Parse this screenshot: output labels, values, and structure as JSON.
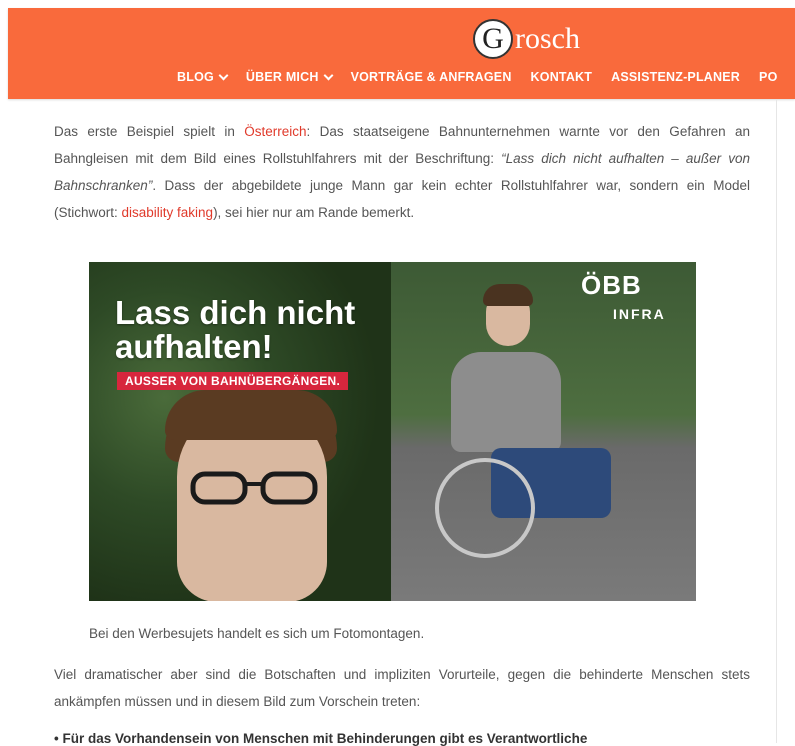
{
  "header": {
    "logo_letter": "G",
    "logo_text": "rosch",
    "nav": [
      {
        "label": "BLOG",
        "dropdown": true
      },
      {
        "label": "ÜBER MICH",
        "dropdown": true
      },
      {
        "label": "VORTRÄGE & ANFRAGEN",
        "dropdown": false
      },
      {
        "label": "KONTAKT",
        "dropdown": false
      },
      {
        "label": "ASSISTENZ-PLANER",
        "dropdown": false
      },
      {
        "label": "PO",
        "dropdown": false
      }
    ]
  },
  "article": {
    "p1_a": "Das erste Beispiel spielt in ",
    "p1_link1": "Österreich",
    "p1_b": ": Das staatseigene Bahnunternehmen warnte vor den Gefahren an Bahngleisen mit dem Bild eines Rollstuhlfahrers mit der Beschriftung: ",
    "p1_quote": "“Lass dich nicht aufhalten – außer von Bahnschranken”",
    "p1_c": ". Dass der abgebildete junge Mann gar kein echter Rollstuhlfahrer war, sondern ein Model (Stichwort: ",
    "p1_link2": "disability faking",
    "p1_d": "), sei hier nur am Rande bemerkt.",
    "image": {
      "headline": "Lass dich nicht aufhalten!",
      "subline": "AUSSER VON BAHNÜBERGÄNGEN.",
      "brand": "ÖBB",
      "brand_sub": "INFRA"
    },
    "caption": "Bei den Werbesujets handelt es sich um Fotomontagen.",
    "p2": "Viel dramatischer aber sind die Botschaften und impliziten Vorurteile, gegen die behinderte Menschen stets ankämpfen müssen und in diesem Bild zum Vorschein treten:",
    "bullet1": "Für das Vorhandensein von Menschen mit Behinderungen gibt es Verantwortliche"
  },
  "colors": {
    "header_bg": "#f96a3c",
    "link": "#e03a2b",
    "ad_red": "#d7263d"
  }
}
